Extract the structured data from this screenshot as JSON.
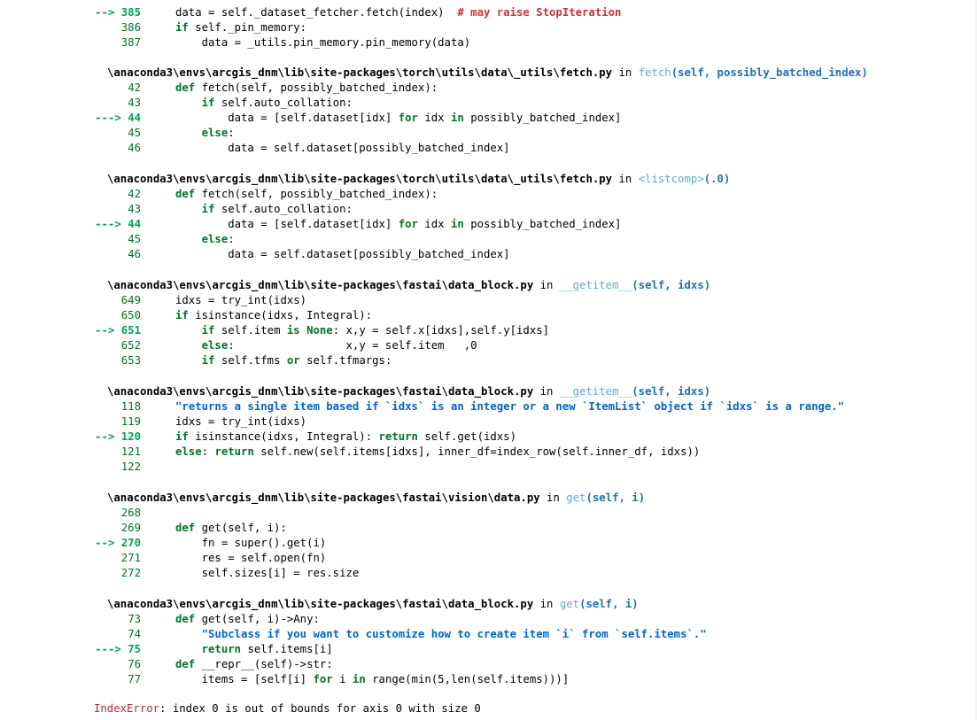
{
  "traceback": {
    "top_partial": [
      {
        "arrow": "-->",
        "no": "385",
        "code": [
          [
            "t-code",
            "data = self._dataset_fetcher.fetch(index)  "
          ],
          [
            "t-com",
            "# may raise StopIteration"
          ]
        ]
      },
      {
        "arrow": "",
        "no": "386",
        "code": [
          [
            "t-kw",
            "if "
          ],
          [
            "t-code",
            "self._pin_memory:"
          ]
        ]
      },
      {
        "arrow": "",
        "no": "387",
        "code": [
          [
            "t-code",
            "    data = _utils.pin_memory.pin_memory(data)"
          ]
        ]
      }
    ],
    "frames": [
      {
        "path": "\\anaconda3\\envs\\arcgis_dnm\\lib\\site-packages\\torch\\utils\\data\\_utils\\fetch.py",
        "in_label": " in ",
        "func": "fetch",
        "args": "(self, possibly_batched_index)",
        "lines": [
          {
            "arrow": "",
            "no": "42",
            "code": [
              [
                "t-kw",
                "def "
              ],
              [
                "t-code",
                "fetch(self, possibly_batched_index):"
              ]
            ]
          },
          {
            "arrow": "",
            "no": "43",
            "code": [
              [
                "t-code",
                "    "
              ],
              [
                "t-kw",
                "if "
              ],
              [
                "t-code",
                "self.auto_collation:"
              ]
            ]
          },
          {
            "arrow": "--->",
            "no": "44",
            "code": [
              [
                "t-code",
                "        data = [self.dataset[idx] "
              ],
              [
                "t-kw",
                "for "
              ],
              [
                "t-code",
                "idx "
              ],
              [
                "t-kw",
                "in "
              ],
              [
                "t-code",
                "possibly_batched_index]"
              ]
            ]
          },
          {
            "arrow": "",
            "no": "45",
            "code": [
              [
                "t-code",
                "    "
              ],
              [
                "t-kw",
                "else"
              ],
              [
                "t-code",
                ":"
              ]
            ]
          },
          {
            "arrow": "",
            "no": "46",
            "code": [
              [
                "t-code",
                "        data = self.dataset[possibly_batched_index]"
              ]
            ]
          }
        ]
      },
      {
        "path": "\\anaconda3\\envs\\arcgis_dnm\\lib\\site-packages\\torch\\utils\\data\\_utils\\fetch.py",
        "in_label": " in ",
        "func": "<listcomp>",
        "args": "(.0)",
        "lines": [
          {
            "arrow": "",
            "no": "42",
            "code": [
              [
                "t-kw",
                "def "
              ],
              [
                "t-code",
                "fetch(self, possibly_batched_index):"
              ]
            ]
          },
          {
            "arrow": "",
            "no": "43",
            "code": [
              [
                "t-code",
                "    "
              ],
              [
                "t-kw",
                "if "
              ],
              [
                "t-code",
                "self.auto_collation:"
              ]
            ]
          },
          {
            "arrow": "--->",
            "no": "44",
            "code": [
              [
                "t-code",
                "        data = [self.dataset[idx] "
              ],
              [
                "t-kw",
                "for "
              ],
              [
                "t-code",
                "idx "
              ],
              [
                "t-kw",
                "in "
              ],
              [
                "t-code",
                "possibly_batched_index]"
              ]
            ]
          },
          {
            "arrow": "",
            "no": "45",
            "code": [
              [
                "t-code",
                "    "
              ],
              [
                "t-kw",
                "else"
              ],
              [
                "t-code",
                ":"
              ]
            ]
          },
          {
            "arrow": "",
            "no": "46",
            "code": [
              [
                "t-code",
                "        data = self.dataset[possibly_batched_index]"
              ]
            ]
          }
        ]
      },
      {
        "path": "\\anaconda3\\envs\\arcgis_dnm\\lib\\site-packages\\fastai\\data_block.py",
        "in_label": " in ",
        "func": "__getitem__",
        "args": "(self, idxs)",
        "lines": [
          {
            "arrow": "",
            "no": "649",
            "code": [
              [
                "t-code",
                "idxs = try_int(idxs)"
              ]
            ]
          },
          {
            "arrow": "",
            "no": "650",
            "code": [
              [
                "t-kw",
                "if "
              ],
              [
                "t-code",
                "isinstance(idxs, Integral):"
              ]
            ]
          },
          {
            "arrow": "-->",
            "no": "651",
            "code": [
              [
                "t-code",
                "    "
              ],
              [
                "t-kw",
                "if "
              ],
              [
                "t-code",
                "self.item "
              ],
              [
                "t-kw",
                "is None"
              ],
              [
                "t-code",
                ": x,y = self.x[idxs],self.y[idxs]"
              ]
            ]
          },
          {
            "arrow": "",
            "no": "652",
            "code": [
              [
                "t-code",
                "    "
              ],
              [
                "t-kw",
                "else"
              ],
              [
                "t-code",
                ":                 x,y = self.item   ,0"
              ]
            ]
          },
          {
            "arrow": "",
            "no": "653",
            "code": [
              [
                "t-code",
                "    "
              ],
              [
                "t-kw",
                "if "
              ],
              [
                "t-code",
                "self.tfms "
              ],
              [
                "t-kw",
                "or "
              ],
              [
                "t-code",
                "self.tfmargs:"
              ]
            ]
          }
        ]
      },
      {
        "path": "\\anaconda3\\envs\\arcgis_dnm\\lib\\site-packages\\fastai\\data_block.py",
        "in_label": " in ",
        "func": "__getitem__",
        "args": "(self, idxs)",
        "lines": [
          {
            "arrow": "",
            "no": "118",
            "code": [
              [
                "t-str",
                "\"returns a single item based if `idxs` is an integer or a new `ItemList` object if `idxs` is a range.\""
              ]
            ]
          },
          {
            "arrow": "",
            "no": "119",
            "code": [
              [
                "t-code",
                "idxs = try_int(idxs)"
              ]
            ]
          },
          {
            "arrow": "-->",
            "no": "120",
            "code": [
              [
                "t-kw",
                "if "
              ],
              [
                "t-code",
                "isinstance(idxs, Integral): "
              ],
              [
                "t-kw",
                "return "
              ],
              [
                "t-code",
                "self.get(idxs)"
              ]
            ]
          },
          {
            "arrow": "",
            "no": "121",
            "code": [
              [
                "t-kw",
                "else"
              ],
              [
                "t-code",
                ": "
              ],
              [
                "t-kw",
                "return "
              ],
              [
                "t-code",
                "self.new(self.items[idxs], inner_df=index_row(self.inner_df, idxs))"
              ]
            ]
          },
          {
            "arrow": "",
            "no": "122",
            "code": [
              [
                "t-code",
                ""
              ]
            ]
          }
        ]
      },
      {
        "path": "\\anaconda3\\envs\\arcgis_dnm\\lib\\site-packages\\fastai\\vision\\data.py",
        "in_label": " in ",
        "func": "get",
        "args": "(self, i)",
        "lines": [
          {
            "arrow": "",
            "no": "268",
            "code": [
              [
                "t-code",
                ""
              ]
            ]
          },
          {
            "arrow": "",
            "no": "269",
            "code": [
              [
                "t-kw",
                "def "
              ],
              [
                "t-code",
                "get(self, i):"
              ]
            ]
          },
          {
            "arrow": "-->",
            "no": "270",
            "code": [
              [
                "t-code",
                "    fn = super().get(i)"
              ]
            ]
          },
          {
            "arrow": "",
            "no": "271",
            "code": [
              [
                "t-code",
                "    res = self.open(fn)"
              ]
            ]
          },
          {
            "arrow": "",
            "no": "272",
            "code": [
              [
                "t-code",
                "    self.sizes[i] = res.size"
              ]
            ]
          }
        ]
      },
      {
        "path": "\\anaconda3\\envs\\arcgis_dnm\\lib\\site-packages\\fastai\\data_block.py",
        "in_label": " in ",
        "func": "get",
        "args": "(self, i)",
        "lines": [
          {
            "arrow": "",
            "no": "73",
            "code": [
              [
                "t-kw",
                "def "
              ],
              [
                "t-code",
                "get(self, i)->Any:"
              ]
            ]
          },
          {
            "arrow": "",
            "no": "74",
            "code": [
              [
                "t-code",
                "    "
              ],
              [
                "t-str",
                "\"Subclass if you want to customize how to create item `i` from `self.items`.\""
              ]
            ]
          },
          {
            "arrow": "--->",
            "no": "75",
            "code": [
              [
                "t-code",
                "    "
              ],
              [
                "t-kw",
                "return "
              ],
              [
                "t-code",
                "self.items[i]"
              ]
            ]
          },
          {
            "arrow": "",
            "no": "76",
            "code": [
              [
                "t-kw",
                "def "
              ],
              [
                "t-code",
                "__repr__(self)->str:"
              ]
            ]
          },
          {
            "arrow": "",
            "no": "77",
            "code": [
              [
                "t-code",
                "    items = [self[i] "
              ],
              [
                "t-kw",
                "for "
              ],
              [
                "t-code",
                "i "
              ],
              [
                "t-kw",
                "in "
              ],
              [
                "t-code",
                "range(min(5,len(self.items)))]"
              ]
            ]
          }
        ]
      }
    ],
    "error": {
      "name": "IndexError",
      "message": ": index 0 is out of bounds for axis 0 with size 0"
    }
  }
}
